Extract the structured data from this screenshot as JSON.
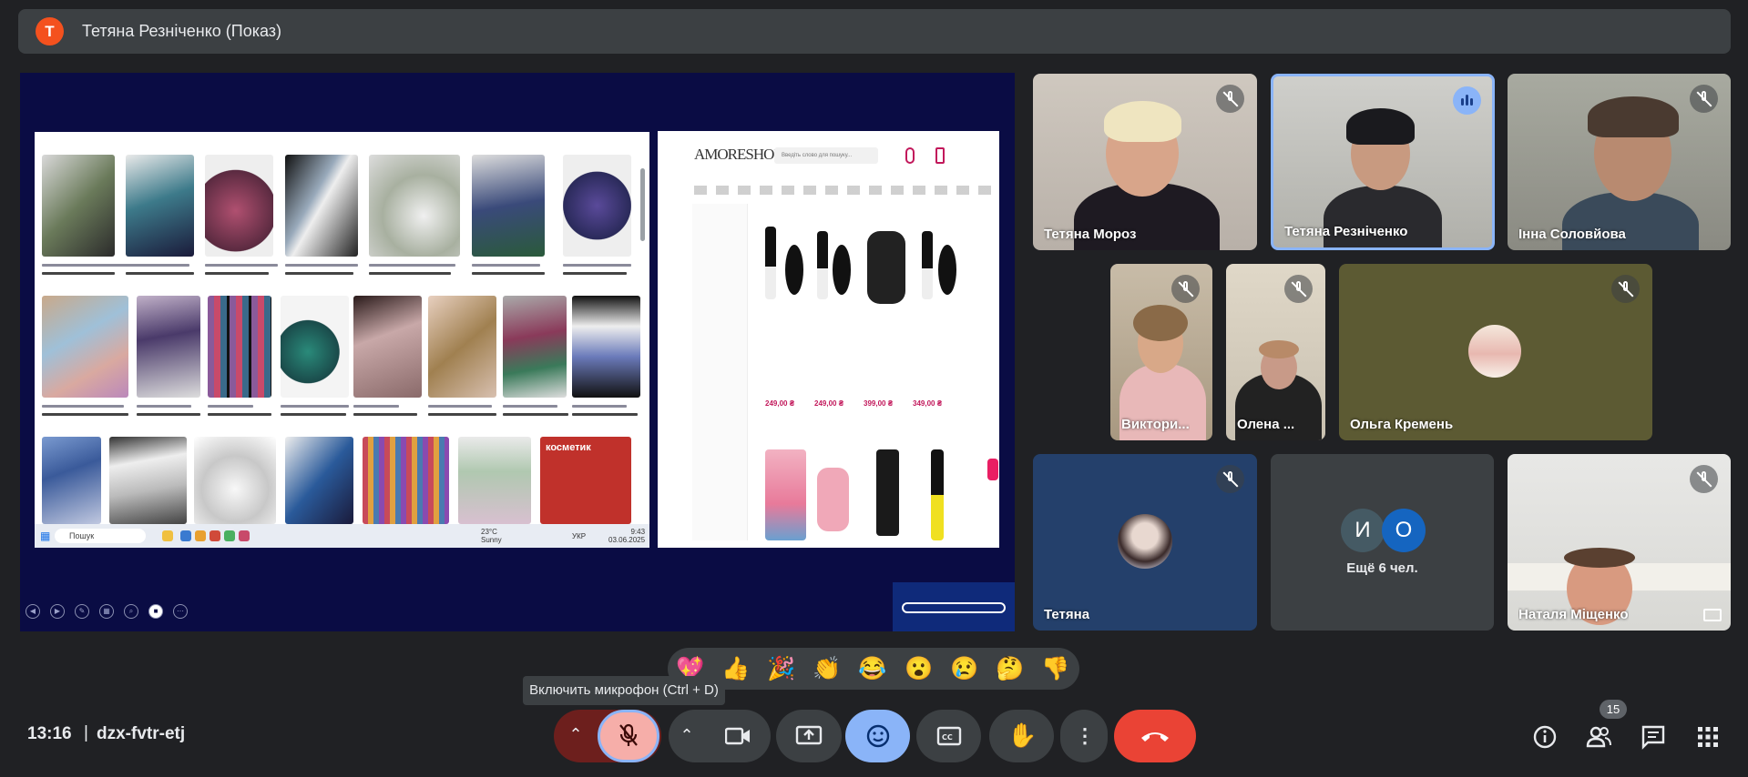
{
  "header": {
    "avatar_letter": "T",
    "avatar_color": "#f4511e",
    "title": "Тетяна Резніченко (Показ)"
  },
  "presentation": {
    "taskbar": {
      "search_placeholder": "Пошук",
      "weather": "23°C",
      "weather_sub": "Sunny",
      "lang": "УКР",
      "time": "9:43",
      "date": "03.06.2025"
    },
    "shop": {
      "logo": "AMORESHOP",
      "search_placeholder": "Введіть слово для пошуку...",
      "prices": [
        "249,00 ₴",
        "249,00 ₴",
        "399,00 ₴",
        "349,00 ₴"
      ],
      "banner_text": "косметик"
    },
    "controls": [
      "prev-icon",
      "next-icon",
      "pen-icon",
      "slides-icon",
      "zoom-icon",
      "camera-icon",
      "more-icon"
    ]
  },
  "participants": [
    {
      "name": "Тетяна Мороз",
      "muted": true
    },
    {
      "name": "Тетяна Резніченко",
      "muted": false,
      "speaking": true
    },
    {
      "name": "Інна Соловйова",
      "muted": true
    },
    {
      "name": "Виктори...",
      "muted": true
    },
    {
      "name": "Олена ...",
      "muted": true
    },
    {
      "name": "Ольга Кремень",
      "muted": true,
      "avatar": true
    },
    {
      "name": "Тетяна",
      "muted": true,
      "avatar": true
    },
    {
      "name": "Наталя Міщенко",
      "muted": true
    }
  ],
  "others": {
    "initials": [
      "И",
      "О"
    ],
    "label": "Ещё 6 чел."
  },
  "reactions": [
    "💖",
    "👍",
    "🎉",
    "👏",
    "😂",
    "😮",
    "😢",
    "🤔",
    "👎"
  ],
  "tooltip": "Включить микрофон (Ctrl + D)",
  "bottom": {
    "time": "13:16",
    "separator": "|",
    "meeting_code": "dzx-fvtr-etj",
    "people_count": "15"
  },
  "colors": {
    "leave": "#ea4335",
    "reactions_active": "#8ab4f8",
    "mic_off": "#f6aea9"
  }
}
